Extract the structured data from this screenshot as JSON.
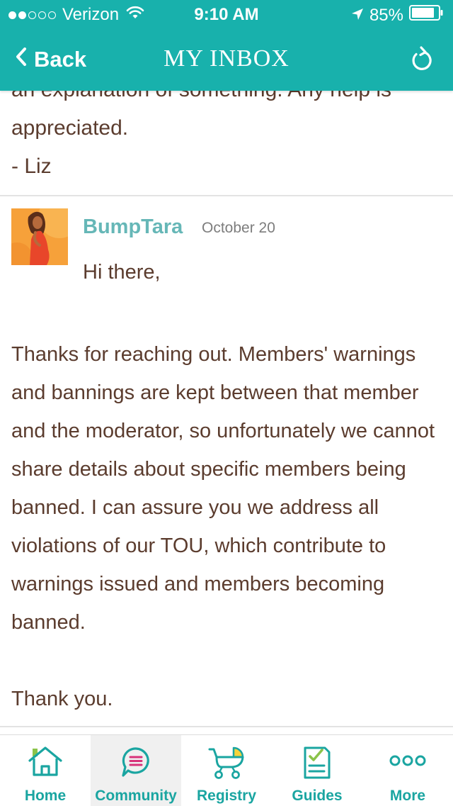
{
  "status_bar": {
    "carrier": "Verizon",
    "time": "9:10 AM",
    "battery": "85%",
    "signal_bars_filled": 2,
    "signal_bars_total": 5
  },
  "nav": {
    "back_label": "Back",
    "title": "MY INBOX"
  },
  "previous_message": {
    "cut_line": "an explanation of something. Any help is",
    "line2": "appreciated.",
    "signature": "- Liz"
  },
  "message": {
    "author": "BumpTara",
    "date": "October 20",
    "greeting": "Hi there,",
    "body": "Thanks for reaching out. Members' warnings and bannings are kept between that member and the moderator, so unfortunately we cannot share details about specific members being banned. I can assure you we address all violations of our TOU, which contribute to warnings issued and members becoming banned.",
    "closing": "Thank you."
  },
  "tabs": [
    {
      "label": "Home",
      "icon": "home-icon",
      "active": false
    },
    {
      "label": "Community",
      "icon": "chat-bubble-icon",
      "active": true
    },
    {
      "label": "Registry",
      "icon": "stroller-icon",
      "active": false
    },
    {
      "label": "Guides",
      "icon": "checklist-icon",
      "active": false
    },
    {
      "label": "More",
      "icon": "more-dots-icon",
      "active": false
    }
  ],
  "colors": {
    "header": "#18b1ac",
    "text": "#5b3c2e",
    "author": "#66b7b7",
    "tab_label": "#1aa5a1",
    "accent_pink": "#d8327a",
    "accent_yellow": "#f5d33a"
  }
}
